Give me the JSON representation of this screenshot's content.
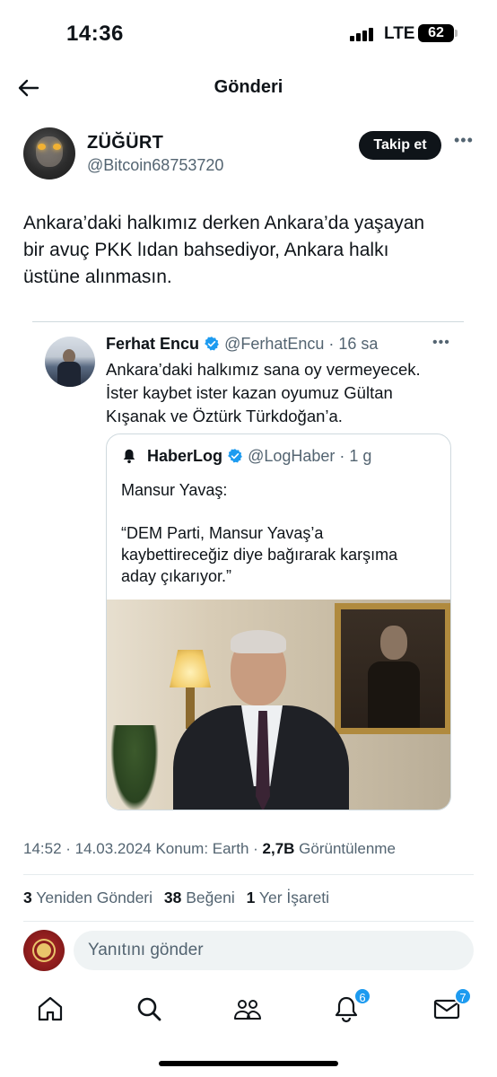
{
  "status_bar": {
    "time": "14:36",
    "network": "LTE",
    "battery": "62"
  },
  "header": {
    "title": "Gönderi"
  },
  "author": {
    "name": "ZÜĞÜRT",
    "handle": "@Bitcoin68753720",
    "follow_label": "Takip et",
    "more_label": "•••"
  },
  "tweet": {
    "text": "Ankara’daki halkımız derken Ankara’da yaşayan\nbir avuç  PKK lıdan bahsediyor, Ankara halkı\nüstüne alınmasın."
  },
  "quoted": {
    "name": "Ferhat Encu",
    "handle_time": "@FerhatEncu · 16 sa",
    "more_label": "•••",
    "text": "Ankara’daki halkımız sana oy vermeyecek.\nİster kaybet ister kazan oyumuz Gültan\nKışanak ve Öztürk Türkdoğan’a."
  },
  "nested_quote": {
    "name": "HaberLog",
    "handle_time": "@LogHaber · 1 g",
    "text": "Mansur Yavaş:\n\n“DEM Parti, Mansur Yavaş’a\nkaybettireceğiz diye bağırarak karşıma\naday çıkarıyor.”"
  },
  "meta": {
    "time_date": "14:52 · 14.03.2024 Konum: Earth · ",
    "views_count": "2,7B",
    "views_label": "Görüntülenme"
  },
  "stats": {
    "reposts_count": "3",
    "reposts_label": "Yeniden Gönderi",
    "likes_count": "38",
    "likes_label": "Beğeni",
    "bookmarks_count": "1",
    "bookmarks_label": "Yer İşareti"
  },
  "reply": {
    "placeholder": "Yanıtını gönder"
  },
  "tabs": {
    "notifications_badge": "6",
    "messages_badge": "7"
  },
  "colors": {
    "accent": "#1d9bf0",
    "text": "#0f1419",
    "secondary": "#536471",
    "border": "#cfd9de"
  }
}
